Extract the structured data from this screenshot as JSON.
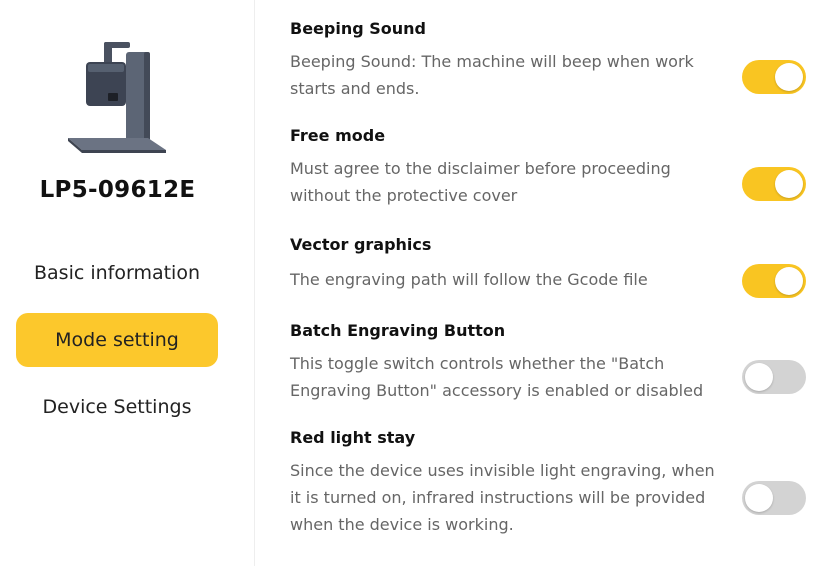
{
  "sidebar": {
    "device_name": "LP5-09612E",
    "nav": [
      {
        "label": "Basic information",
        "active": false
      },
      {
        "label": "Mode setting",
        "active": true
      },
      {
        "label": "Device Settings",
        "active": false
      }
    ]
  },
  "settings": [
    {
      "title": "Beeping Sound",
      "description": "Beeping Sound: The machine will beep when work starts and ends.",
      "enabled": true
    },
    {
      "title": "Free mode",
      "description": "Must agree to the disclaimer before proceeding without the protective cover",
      "enabled": true
    },
    {
      "title": "Vector graphics",
      "description": "The engraving path will follow the Gcode file",
      "enabled": true
    },
    {
      "title": "Batch Engraving Button",
      "description": "This toggle switch controls whether the \"Batch Engraving Button\" accessory is enabled or disabled",
      "enabled": false
    },
    {
      "title": "Red light stay",
      "description": "Since the device uses invisible light engraving, when it is turned on, infrared instructions will be provided when the device is working.",
      "enabled": false
    }
  ],
  "colors": {
    "accent": "#fcc82c",
    "toggle_on": "#f9c522",
    "toggle_off": "#d3d3d3"
  }
}
